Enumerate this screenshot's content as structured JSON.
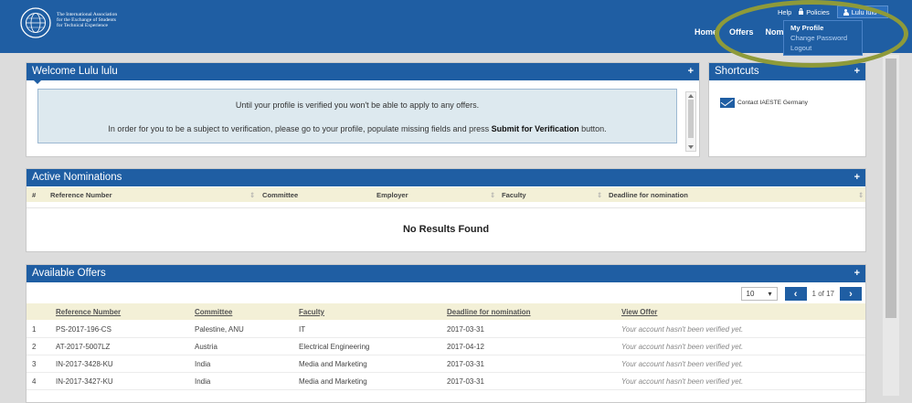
{
  "header": {
    "org_line1": "The International Association",
    "org_line2": "for the Exchange of Students",
    "org_line3": "for Technical Experience",
    "help": "Help",
    "policies": "Policies",
    "user": "Lulu lulu",
    "nav": [
      "Home",
      "Offers",
      "Nominations"
    ]
  },
  "user_menu": {
    "items": [
      "My Profile",
      "Change Password",
      "Logout"
    ]
  },
  "welcome": {
    "title": "Welcome Lulu lulu",
    "line1": "Until your profile is verified you won't be able to apply to any offers.",
    "line2_pre": "In order for you to be a subject to verification, please go to your profile, populate missing fields and press",
    "line2_bold": "Submit for Verification",
    "line2_post": "button."
  },
  "shortcuts": {
    "title": "Shortcuts",
    "contact": "Contact IAESTE Germany"
  },
  "nominations": {
    "title": "Active Nominations",
    "columns": [
      "#",
      "Reference Number",
      "Committee",
      "Employer",
      "Faculty",
      "Deadline for nomination"
    ],
    "empty": "No Results Found"
  },
  "offers": {
    "title": "Available Offers",
    "page_size": "10",
    "page_info": "1 of 17",
    "columns": [
      "Reference Number",
      "Committee",
      "Faculty",
      "Deadline for nomination",
      "View Offer"
    ],
    "rows": [
      {
        "n": "1",
        "ref": "PS-2017-196-CS",
        "committee": "Palestine, ANU",
        "faculty": "IT",
        "deadline": "2017-03-31",
        "view": "Your account hasn't been verified yet."
      },
      {
        "n": "2",
        "ref": "AT-2017-5007LZ",
        "committee": "Austria",
        "faculty": "Electrical Engineering",
        "deadline": "2017-04-12",
        "view": "Your account hasn't been verified yet."
      },
      {
        "n": "3",
        "ref": "IN-2017-3428-KU",
        "committee": "India",
        "faculty": "Media and Marketing",
        "deadline": "2017-03-31",
        "view": "Your account hasn't been verified yet."
      },
      {
        "n": "4",
        "ref": "IN-2017-3427-KU",
        "committee": "India",
        "faculty": "Media and Marketing",
        "deadline": "2017-03-31",
        "view": "Your account hasn't been verified yet."
      }
    ]
  },
  "colors": {
    "brand": "#1f5ea3",
    "header_row": "#f3f0d7",
    "notice_bg": "#dde9ef",
    "highlight": "#8e9a3a"
  }
}
